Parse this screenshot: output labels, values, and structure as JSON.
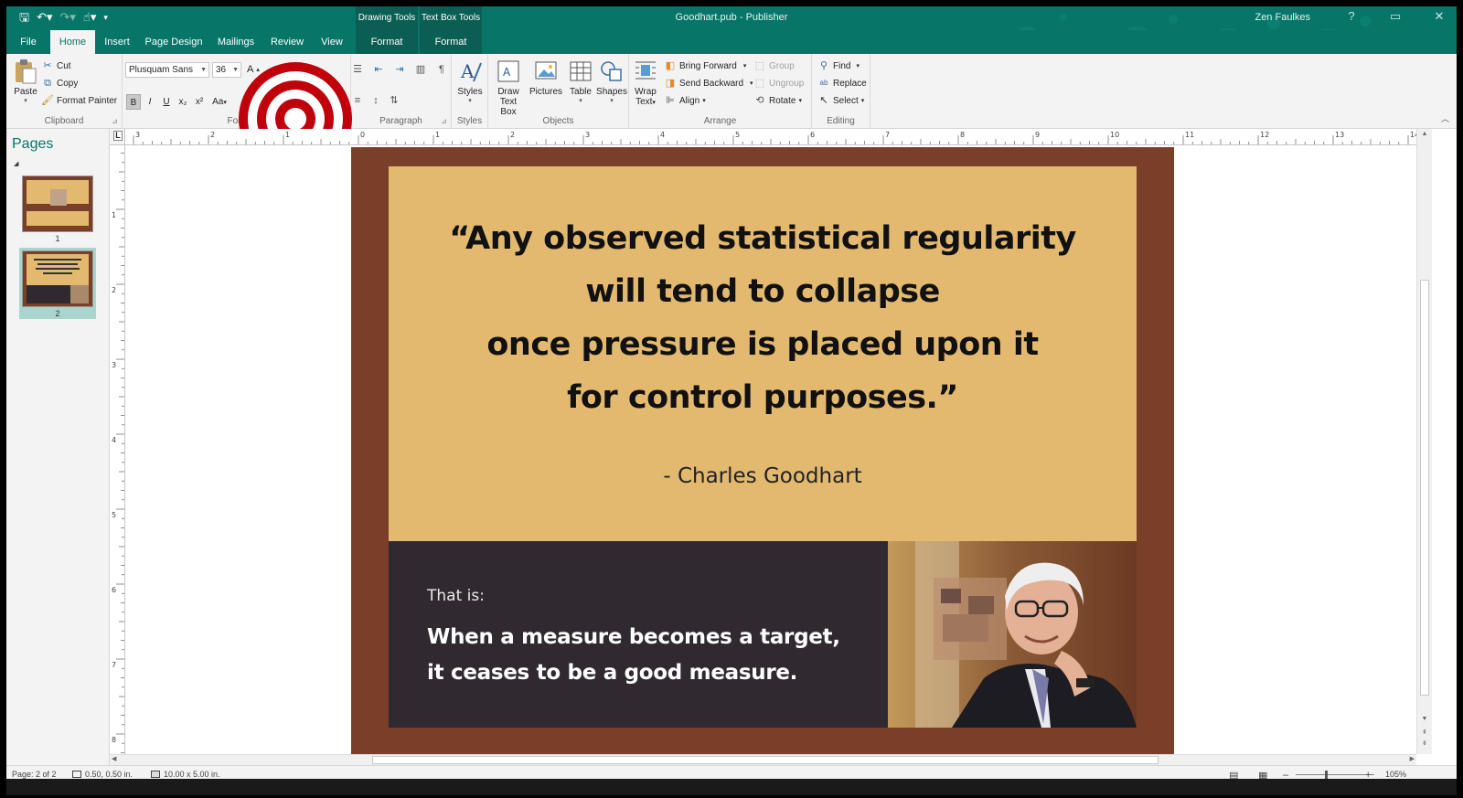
{
  "titlebar": {
    "doc_title": "Goodhart.pub  -  Publisher",
    "user": "Zen Faulkes",
    "help": "?",
    "restore": "▭",
    "close": "✕",
    "drawing_tools": "Drawing Tools",
    "textbox_tools": "Text Box Tools"
  },
  "tabs": {
    "file": "File",
    "home": "Home",
    "insert": "Insert",
    "page_design": "Page Design",
    "mailings": "Mailings",
    "review": "Review",
    "view": "View",
    "format1": "Format",
    "format2": "Format"
  },
  "ribbon": {
    "clipboard": {
      "paste": "Paste",
      "cut": "Cut",
      "copy": "Copy",
      "format_painter": "Format Painter",
      "label": "Clipboard"
    },
    "font": {
      "name": "Plusquam Sans",
      "size": "36",
      "bold": "B",
      "italic": "I",
      "underline": "U",
      "subscript": "x₂",
      "superscript": "x²",
      "change_case": "Aa",
      "grow": "A",
      "label": "Font"
    },
    "paragraph": {
      "label": "Paragraph",
      "pilcrow": "¶"
    },
    "styles": {
      "button": "Styles",
      "label": "Styles"
    },
    "objects": {
      "draw_text_box_1": "Draw",
      "draw_text_box_2": "Text Box",
      "pictures": "Pictures",
      "table": "Table",
      "shapes": "Shapes",
      "label": "Objects"
    },
    "arrange": {
      "wrap_text_1": "Wrap",
      "wrap_text_2": "Text",
      "bring_forward": "Bring Forward",
      "send_backward": "Send Backward",
      "align": "Align",
      "group": "Group",
      "ungroup": "Ungroup",
      "rotate": "Rotate",
      "label": "Arrange"
    },
    "editing": {
      "find": "Find",
      "replace": "Replace",
      "select": "Select",
      "label": "Editing"
    }
  },
  "pages_pane": {
    "title": "Pages",
    "pages": [
      "1",
      "2"
    ],
    "selected": "2"
  },
  "ruler": {
    "h_labels": [
      "3",
      "2",
      "1",
      "0",
      "1",
      "2",
      "3",
      "4",
      "5",
      "6",
      "7",
      "8",
      "9",
      "10",
      "11",
      "12",
      "13",
      "14"
    ],
    "v_labels": [
      "1",
      "2",
      "3",
      "4",
      "5",
      "6",
      "7",
      "8"
    ],
    "corner": "L"
  },
  "slide": {
    "quote_lines": [
      "“Any observed statistical regularity",
      "will tend to collapse",
      "once pressure is placed upon it",
      "for control purposes.”"
    ],
    "author": "- Charles Goodhart",
    "that_is": "That is:",
    "punch_lines": [
      "When a measure becomes a target,",
      "it ceases to be a good measure."
    ],
    "colors": {
      "frame": "#7a3f29",
      "quote_bg": "#e2b96f",
      "dark_bg": "#302a30"
    }
  },
  "status": {
    "page": "Page: 2 of 2",
    "position": "0.50, 0.50 in.",
    "size": "10.00 x  5.00 in.",
    "zoom": "105%",
    "zoom_minus": "–",
    "zoom_plus": "+"
  },
  "theme": {
    "accent": "#077568",
    "bullseye": "#c0000b"
  }
}
